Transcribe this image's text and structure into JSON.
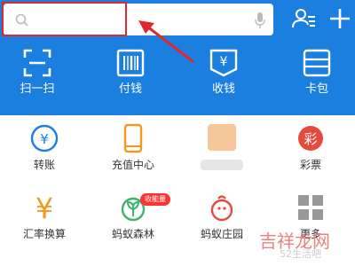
{
  "search": {
    "placeholder": ""
  },
  "quick_actions": [
    {
      "label": "扫一扫",
      "icon": "scan-icon"
    },
    {
      "label": "付钱",
      "icon": "barcode-icon"
    },
    {
      "label": "收钱",
      "icon": "receive-money-icon"
    },
    {
      "label": "卡包",
      "icon": "card-wallet-icon"
    }
  ],
  "grid": [
    {
      "label": "转账",
      "icon": "transfer-icon"
    },
    {
      "label": "充值中心",
      "icon": "phone-topup-icon"
    },
    {
      "label": "",
      "icon": "blurred-icon"
    },
    {
      "label": "彩票",
      "icon": "lottery-icon"
    },
    {
      "label": "汇率换算",
      "icon": "exchange-rate-icon"
    },
    {
      "label": "蚂蚁森林",
      "icon": "ant-forest-icon"
    },
    {
      "label": "蚂蚁庄园",
      "icon": "ant-farm-icon"
    },
    {
      "label": "更多",
      "icon": "more-grid-icon"
    }
  ],
  "badge": {
    "text": "收能量"
  },
  "lottery_glyph": "彩",
  "receive_glyph": "¥",
  "transfer_glyph": "¥",
  "exchange_glyph": "¥",
  "watermark": {
    "main": "吉祥龙网",
    "sub": "52生活吧"
  },
  "colors": {
    "header": "#1b7fe0",
    "highlight": "#e0272e",
    "orange": "#f39a1e",
    "red": "#e54b3c",
    "green": "#3cb371"
  }
}
